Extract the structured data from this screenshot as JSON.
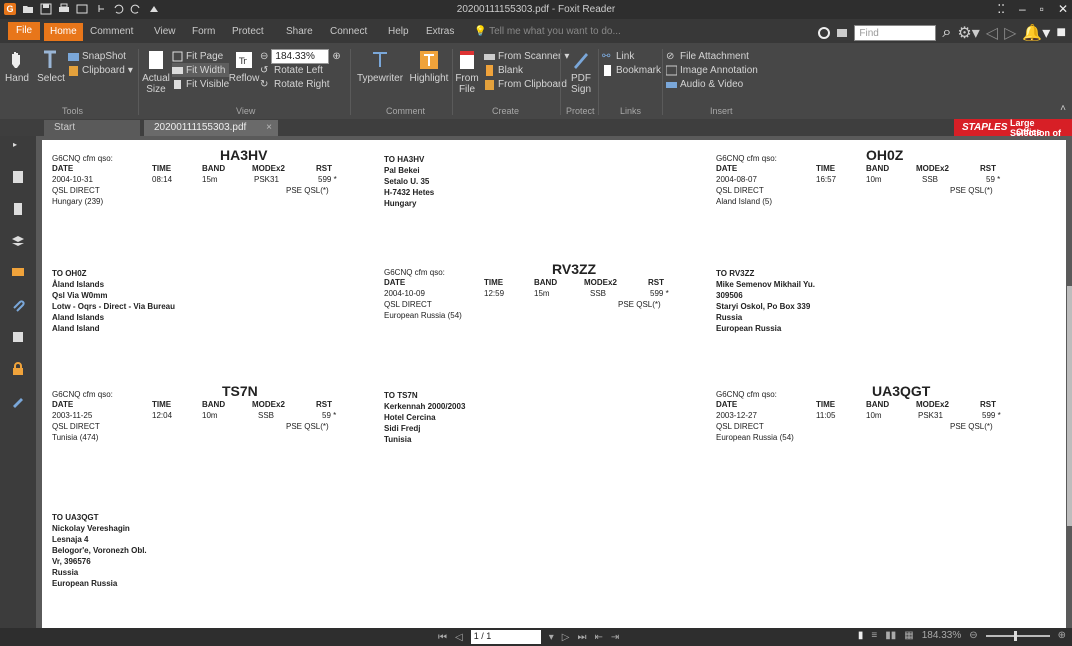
{
  "window": {
    "title": "20200111155303.pdf - Foxit Reader"
  },
  "ribbon_tabs": [
    "File",
    "Home",
    "Comment",
    "View",
    "Form",
    "Protect",
    "Share",
    "Connect",
    "Help",
    "Extras"
  ],
  "tell_me": "Tell me what you want to do...",
  "find_placeholder": "Find",
  "ribbon": {
    "hand": "Hand",
    "select": "Select",
    "snapshot": "SnapShot",
    "clipboard": "Clipboard",
    "actual_size": "Actual Size",
    "fit_page": "Fit Page",
    "fit_width": "Fit Width",
    "fit_visible": "Fit Visible",
    "reflow": "Reflow",
    "zoom_value": "184.33%",
    "rotate_left": "Rotate Left",
    "rotate_right": "Rotate Right",
    "typewriter": "Typewriter",
    "highlight": "Highlight",
    "from_file": "From File",
    "from_scanner": "From Scanner",
    "blank": "Blank",
    "from_clipboard": "From Clipboard",
    "pdf_sign": "PDF Sign",
    "link": "Link",
    "bookmark": "Bookmark",
    "file_attachment": "File Attachment",
    "image_annotation": "Image Annotation",
    "audio_video": "Audio & Video",
    "groups": [
      "Tools",
      "View",
      "Comment",
      "Create",
      "Protect",
      "Links",
      "Insert"
    ]
  },
  "doc_tabs": {
    "start": "Start",
    "doc": "20200111155303.pdf"
  },
  "ad": {
    "brand": "STAPLES",
    "line1": "Large Selection of",
    "line2": "Office Products"
  },
  "labels": {
    "cfm": "G6CNQ cfm qso:",
    "date": "DATE",
    "time": "TIME",
    "band": "BAND",
    "mode": "MODEx2",
    "rst": "RST",
    "qsl_direct": "QSL DIRECT",
    "pse_qsl": "PSE QSL(*)"
  },
  "qsos": [
    {
      "call": "HA3HV",
      "date": "2004-10-31",
      "time": "08:14",
      "band": "15m",
      "mode": "PSK31",
      "rst": "599 *",
      "country": "Hungary (239)"
    },
    {
      "call": "OH0Z",
      "date": "2004-08-07",
      "time": "16:57",
      "band": "10m",
      "mode": "SSB",
      "rst": "59 *",
      "country": "Aland Island (5)"
    },
    {
      "call": "RV3ZZ",
      "date": "2004-10-09",
      "time": "12:59",
      "band": "15m",
      "mode": "SSB",
      "rst": "599 *",
      "country": "European Russia (54)"
    },
    {
      "call": "TS7N",
      "date": "2003-11-25",
      "time": "12:04",
      "band": "10m",
      "mode": "SSB",
      "rst": "59 *",
      "country": "Tunisia (474)"
    },
    {
      "call": "UA3QGT",
      "date": "2003-12-27",
      "time": "11:05",
      "band": "10m",
      "mode": "PSK31",
      "rst": "599 *",
      "country": "European Russia (54)"
    }
  ],
  "addresses": {
    "ha3hv": [
      "TO HA3HV",
      "Pal Bekei",
      "Setalo U. 35",
      "H-7432 Hetes",
      "Hungary"
    ],
    "oh0z": [
      "TO OH0Z",
      "Åland Islands",
      "Qsl Via W0mm",
      "Lotw - Oqrs - Direct - Via Bureau",
      "Aland Islands",
      "Aland Island"
    ],
    "rv3zz": [
      "TO RV3ZZ",
      "Mike Semenov Mikhail Yu.",
      "309506",
      "Staryi Oskol, Po Box 339",
      "Russia",
      "European Russia"
    ],
    "ts7n": [
      "TO TS7N",
      "Kerkennah 2000/2003",
      "Hotel Cercina",
      "Sidi Fredj",
      "Tunisia"
    ],
    "ua3qgt": [
      "TO UA3QGT",
      "Nickolay Vereshagin",
      "Lesnaja 4",
      "Belogor'e, Voronezh Obl.",
      "Vr, 396576",
      "Russia",
      "European Russia"
    ]
  },
  "status": {
    "page": "1 / 1",
    "zoom": "184.33%"
  },
  "colors": {
    "accent": "#e8761a",
    "ad_red": "#d71f26"
  }
}
